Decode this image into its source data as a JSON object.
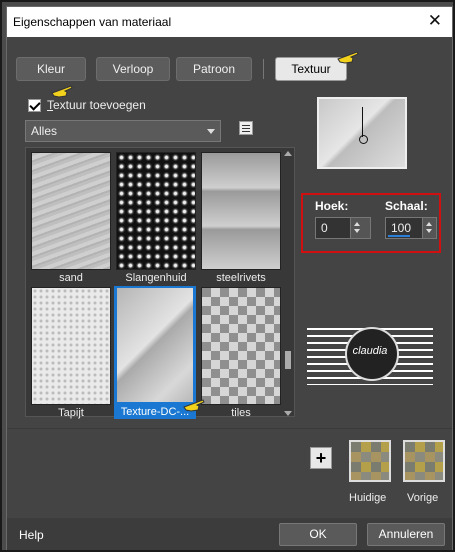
{
  "window": {
    "title": "Eigenschappen van materiaal",
    "close_glyph": "✕"
  },
  "tabs": [
    {
      "label": "Kleur",
      "active": false
    },
    {
      "label": "Verloop",
      "active": false
    },
    {
      "label": "Patroon",
      "active": false
    },
    {
      "label": "Textuur",
      "active": true
    }
  ],
  "texture": {
    "checkbox_label_first": "T",
    "checkbox_label_rest": "extuur toevoegen",
    "checked": true,
    "category_selected": "Alles"
  },
  "gallery": {
    "items": [
      {
        "label": "sand",
        "selected": false
      },
      {
        "label": "Slangenhuid",
        "selected": false
      },
      {
        "label": "steelrivets",
        "selected": false
      },
      {
        "label": "Tapijt",
        "selected": false
      },
      {
        "label": "Texture-DC-...",
        "selected": true
      },
      {
        "label": "tiles",
        "selected": false
      }
    ]
  },
  "params": {
    "angle_label": "Hoek:",
    "angle_value": "0",
    "scale_label": "Schaal:",
    "scale_value": "100"
  },
  "logo": {
    "text": "claudia"
  },
  "swatches": {
    "current_label": "Huidige",
    "previous_label": "Vorige",
    "add_glyph": "+"
  },
  "footer": {
    "help": "Help",
    "ok": "OK",
    "cancel": "Annuleren"
  },
  "colors": {
    "accent": "#1a78d2",
    "highlight_border": "#d01010",
    "pointer": "#f2d21b"
  },
  "icons": [
    "close-icon",
    "hand-pointer-icon",
    "list-icon",
    "dropdown-arrow-icon",
    "plus-icon"
  ]
}
